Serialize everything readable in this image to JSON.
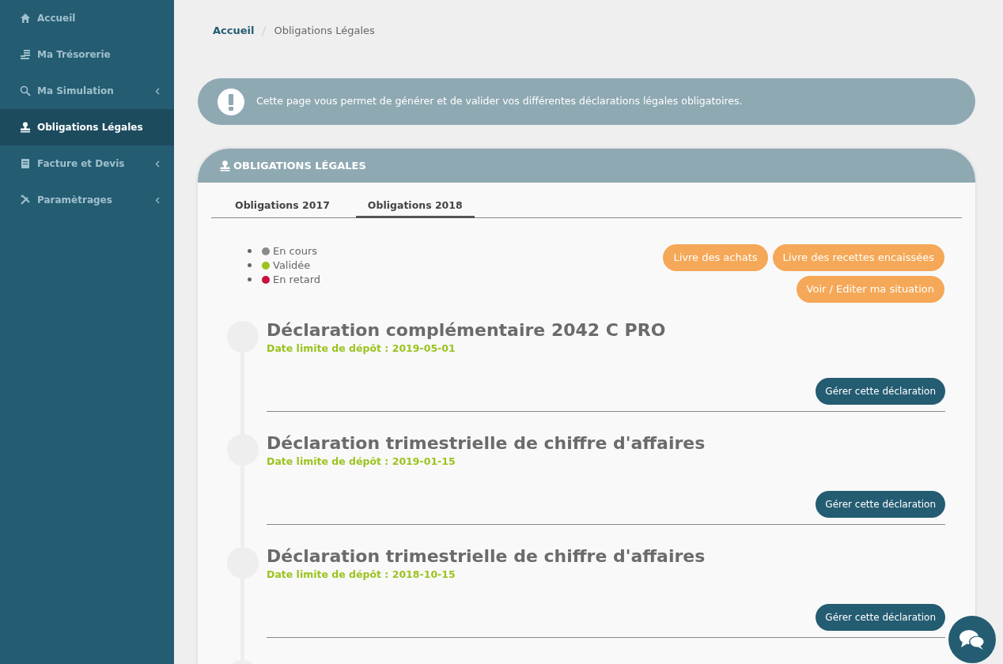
{
  "sidebar": {
    "items": [
      {
        "label": "Accueil",
        "selected": false,
        "has_submenu": false
      },
      {
        "label": "Ma Trésorerie",
        "selected": false,
        "has_submenu": false
      },
      {
        "label": "Ma Simulation",
        "selected": false,
        "has_submenu": true
      },
      {
        "label": "Obligations Légales",
        "selected": true,
        "has_submenu": false
      },
      {
        "label": "Facture et Devis",
        "selected": false,
        "has_submenu": true
      },
      {
        "label": "Paramètrages",
        "selected": false,
        "has_submenu": true
      }
    ]
  },
  "breadcrumb": [
    "Accueil",
    "Obligations Légales"
  ],
  "info_banner": {
    "text": "Cette page vous permet de générer et de valider vos différentes déclarations légales obligatoires."
  },
  "card": {
    "title": "OBLIGATIONS LÉGALES",
    "tabs": [
      {
        "label": "Obligations 2017",
        "selected": false
      },
      {
        "label": "Obligations 2018",
        "selected": true
      }
    ],
    "legend": [
      {
        "label": "En cours",
        "color": "#8a8a8a"
      },
      {
        "label": "Validée",
        "color": "#9bc31e"
      },
      {
        "label": "En retard",
        "color": "#c8103e"
      }
    ],
    "actions": [
      [
        "Livre des achats",
        "Livre des recettes encaissées"
      ],
      [
        "Voir / Editer ma situation"
      ]
    ],
    "declarations": [
      {
        "title": "Déclaration complémentaire 2042 C PRO",
        "deadline": "Date limite de dépôt : 2019-05-01",
        "button": "Gérer cette déclaration"
      },
      {
        "title": "Déclaration trimestrielle de chiffre d'affaires",
        "deadline": "Date limite de dépôt : 2019-01-15",
        "button": "Gérer cette déclaration"
      },
      {
        "title": "Déclaration trimestrielle de chiffre d'affaires",
        "deadline": "Date limite de dépôt : 2018-10-15",
        "button": "Gérer cette déclaration"
      }
    ]
  }
}
